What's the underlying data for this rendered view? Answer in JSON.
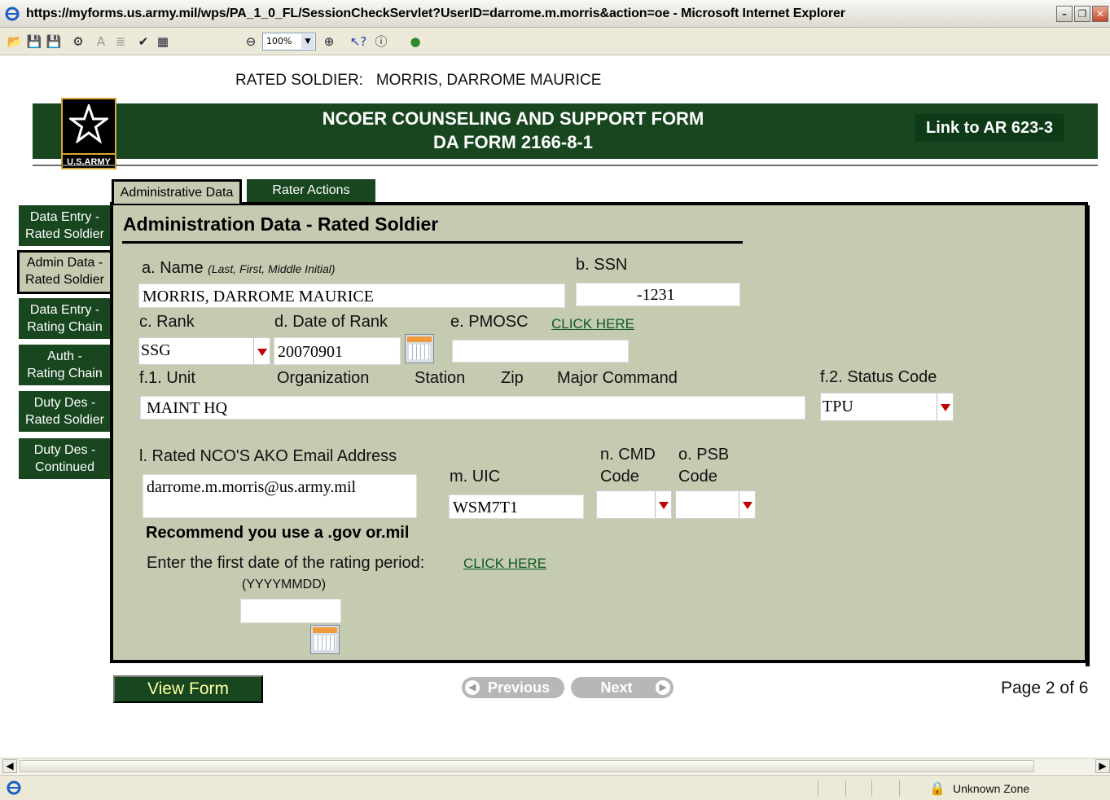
{
  "browser": {
    "title": "https://myforms.us.army.mil/wps/PA_1_0_FL/SessionCheckServlet?UserID=darrome.m.morris&action=oe - Microsoft Internet Explorer",
    "zoom": "100%",
    "status_zone": "Unknown Zone"
  },
  "header": {
    "rated_soldier_label": "RATED SOLDIER:",
    "rated_soldier_name": "MORRIS, DARROME MAURICE",
    "title_line1": "NCOER COUNSELING AND SUPPORT FORM",
    "title_line2": "DA FORM 2166-8-1",
    "ar_link": "Link to AR 623-3",
    "logo_text": "U.S.ARMY"
  },
  "tabs": [
    {
      "label": "Administrative Data",
      "active": true
    },
    {
      "label": "Rater Actions",
      "active": false
    }
  ],
  "left_nav": [
    {
      "line1": "Data Entry -",
      "line2": "Rated Soldier"
    },
    {
      "line1": "Admin Data -",
      "line2": "Rated Soldier"
    },
    {
      "line1": "Data Entry -",
      "line2": "Rating Chain"
    },
    {
      "line1": "Auth -",
      "line2": "Rating Chain"
    },
    {
      "line1": "Duty Des -",
      "line2": "Rated Soldier"
    },
    {
      "line1": "Duty Des -",
      "line2": "Continued"
    }
  ],
  "form": {
    "heading": "Administration Data - Rated Soldier",
    "name_label": "a. Name",
    "name_hint": "(Last, First, Middle Initial)",
    "name_value": "MORRIS, DARROME MAURICE",
    "ssn_label": "b. SSN",
    "ssn_value": "-1231",
    "rank_label": "c. Rank",
    "rank_value": "SSG",
    "dor_label": "d. Date of Rank",
    "dor_value": "20070901",
    "pmosc_label": "e. PMOSC",
    "pmosc_link": "CLICK HERE",
    "pmosc_value": "",
    "unit_label": "f.1. Unit",
    "org_label": "Organization",
    "station_label": "Station",
    "zip_label": "Zip",
    "major_command_label": "Major Command",
    "unit_value": "MAINT HQ",
    "status_code_label": "f.2. Status Code",
    "status_code_value": "TPU",
    "email_label": "l. Rated NCO'S AKO Email Address",
    "email_value": "darrome.m.morris@us.army.mil",
    "uic_label": "m. UIC",
    "uic_value": "WSM7T1",
    "cmd_label_1": "n. CMD",
    "cmd_label_2": "Code",
    "cmd_value": "",
    "psb_label_1": "o. PSB",
    "psb_label_2": "Code",
    "psb_value": "",
    "recommend_note": "Recommend you use a .gov or.mil",
    "first_date_label": "Enter the first date of the rating period:",
    "first_date_link": "CLICK HERE",
    "first_date_format": "(YYYYMMDD)",
    "first_date_value": ""
  },
  "footer": {
    "view_form": "View Form",
    "previous": "Previous",
    "next": "Next",
    "page_indicator": "Page 2 of 6"
  },
  "colors": {
    "army_green": "#17461f",
    "panel_bg": "#c4cbb1",
    "link_green": "#0f5a22",
    "dropdown_arrow": "#c00000"
  }
}
